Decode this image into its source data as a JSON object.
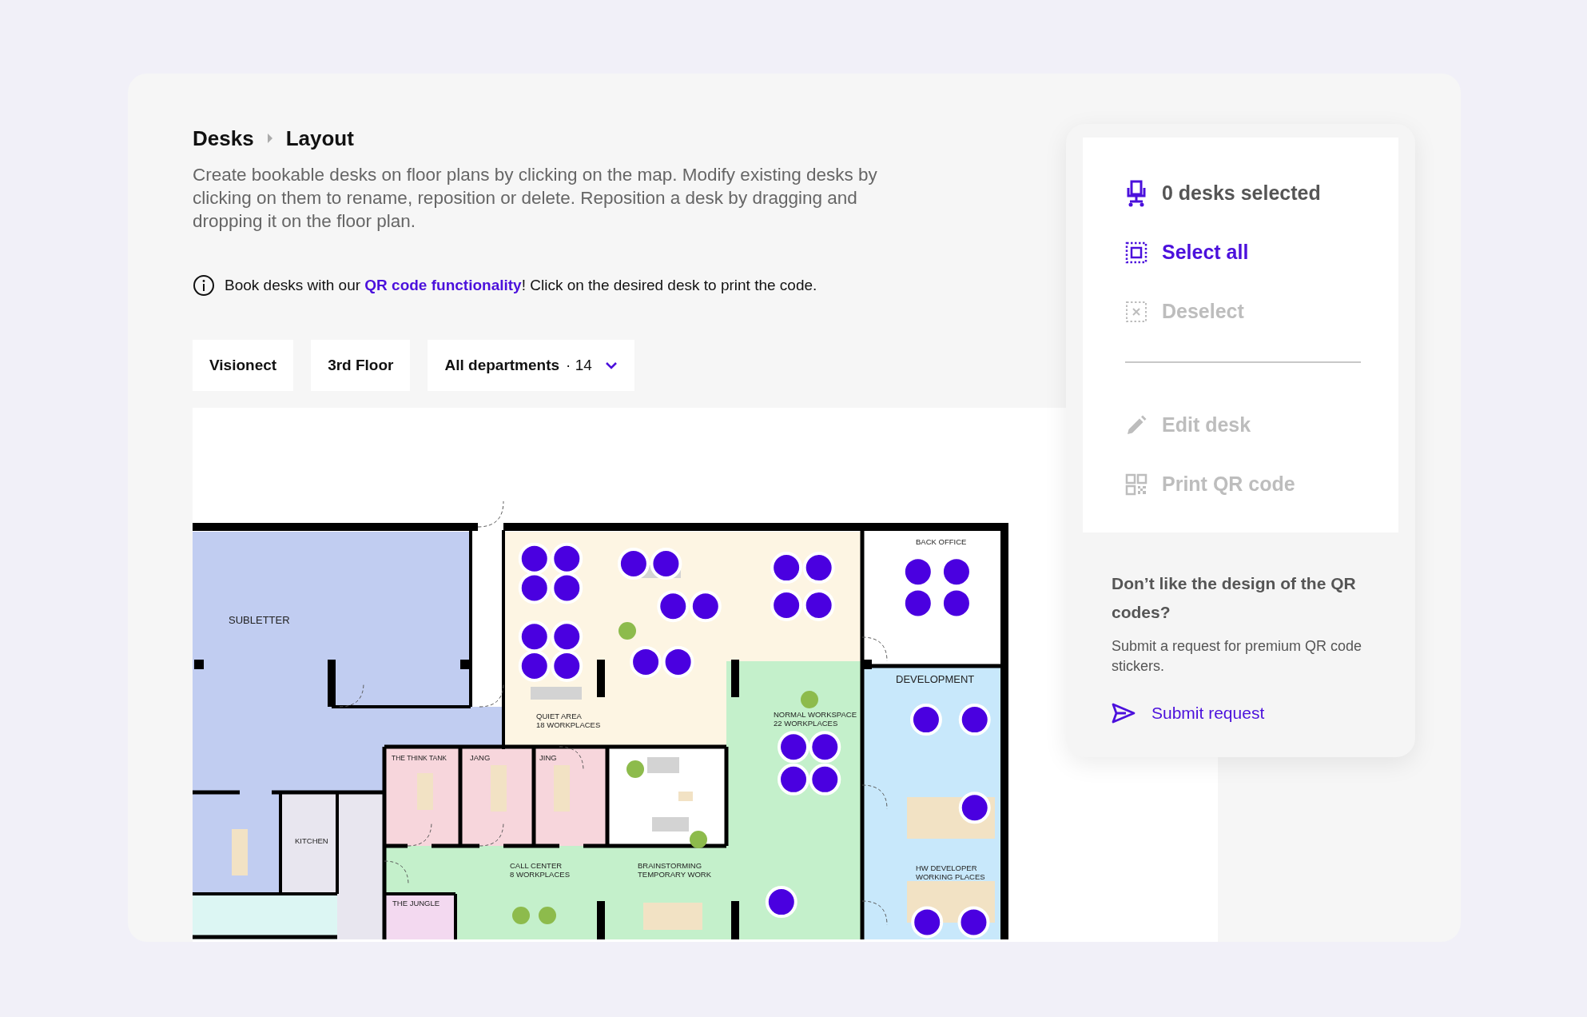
{
  "breadcrumb": [
    {
      "label": "Desks"
    },
    {
      "label": "Layout"
    }
  ],
  "description": "Create bookable desks on floor plans by clicking on the map. Modify existing desks by clicking on them to rename, reposition or delete. Reposition a desk by dragging and dropping it on the floor plan.",
  "info": {
    "before": "Book desks with our ",
    "link": "QR code functionality",
    "after": "! Click on the desired desk to print the code."
  },
  "filters": [
    {
      "label": "Visionect"
    },
    {
      "label": "3rd Floor"
    },
    {
      "label": "All departments",
      "meta": "· 14",
      "dropdown": true
    }
  ],
  "floor_plan": {
    "rooms": [
      {
        "lines": [
          "SUBLETTER"
        ]
      },
      {
        "lines": [
          "QUIET AREA",
          "18 WORKPLACES"
        ]
      },
      {
        "lines": [
          "THE THINK TANK"
        ]
      },
      {
        "lines": [
          "JANG"
        ]
      },
      {
        "lines": [
          "JING"
        ]
      },
      {
        "lines": [
          "KITCHEN"
        ]
      },
      {
        "lines": [
          "CALL CENTER",
          "8 WORKPLACES"
        ]
      },
      {
        "lines": [
          "BRAINSTORMING",
          "TEMPORARY WORK"
        ]
      },
      {
        "lines": [
          "THE JUNGLE"
        ]
      },
      {
        "lines": [
          "NORMAL WORKSPACE",
          "22 WORKPLACES"
        ]
      },
      {
        "lines": [
          "BACK OFFICE"
        ]
      },
      {
        "lines": [
          "DEVELOPMENT"
        ]
      },
      {
        "lines": [
          "HW DEVELOPER",
          "WORKING PLACES"
        ]
      }
    ]
  },
  "panel": {
    "items": [
      {
        "kind": "count",
        "label": "0 desks selected"
      },
      {
        "kind": "action",
        "label": "Select all",
        "disabled": false
      },
      {
        "kind": "action",
        "label": "Deselect",
        "disabled": true
      },
      {
        "kind": "divider"
      },
      {
        "kind": "action",
        "label": "Edit desk",
        "disabled": true
      },
      {
        "kind": "action",
        "label": "Print QR code",
        "disabled": true
      }
    ],
    "promo": {
      "title": "Don’t like the design of the QR codes?",
      "text": "Submit a request for premium QR code stickers.",
      "link": "Submit request"
    }
  }
}
